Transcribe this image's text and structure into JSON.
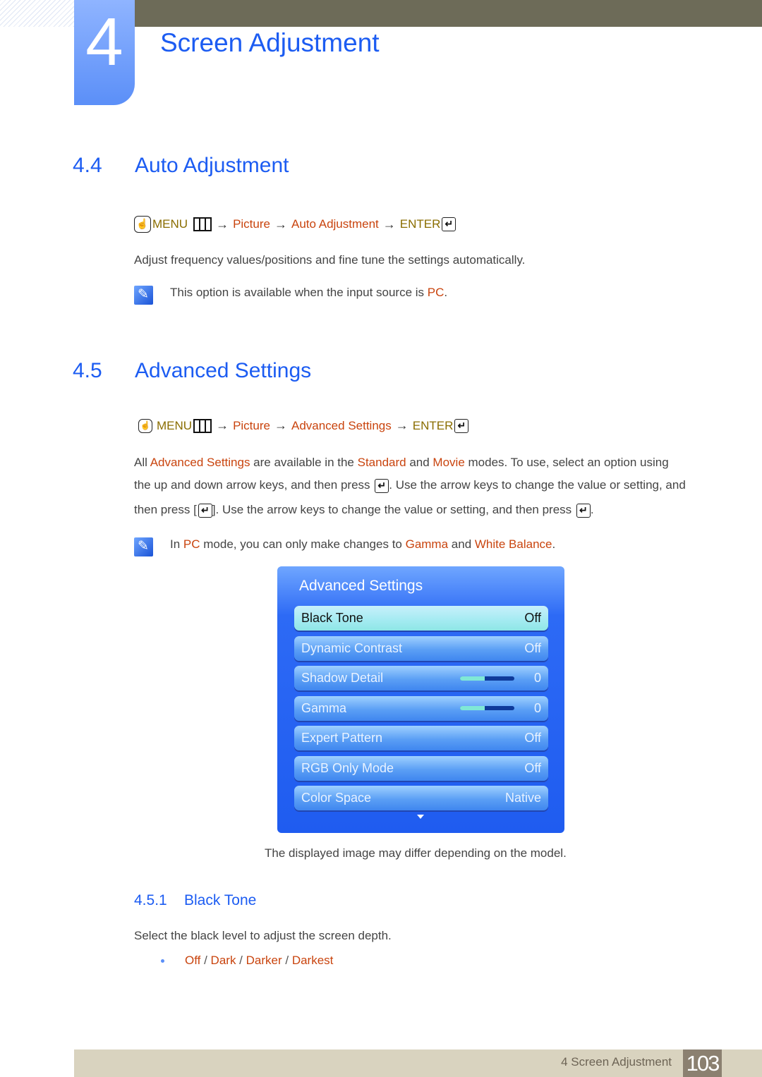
{
  "chapter": {
    "number": "4",
    "title": "Screen Adjustment"
  },
  "section_44": {
    "number": "4.4",
    "title": "Auto Adjustment",
    "menu_path": {
      "menu": "MENU",
      "arrow": "→",
      "items": [
        "Picture",
        "Auto Adjustment"
      ],
      "enter": "ENTER"
    },
    "description": "Adjust frequency values/positions and fine tune the settings automatically.",
    "note": {
      "text_before": "This option is available when the input source is ",
      "highlight": "PC",
      "text_after": "."
    }
  },
  "section_45": {
    "number": "4.5",
    "title": "Advanced Settings",
    "menu_path": {
      "menu": "MENU",
      "arrow": "→",
      "items": [
        "Picture",
        "Advanced Settings"
      ],
      "enter": "ENTER"
    },
    "paragraph": {
      "p1": "All ",
      "h1": "Advanced Settings",
      "p2": " are available in the ",
      "h2": "Standard",
      "p3": " and ",
      "h3": "Movie",
      "p4": " modes. To use, select an option using",
      "line2a": "the up and down arrow keys, and then press ",
      "line2b": ". Use the arrow keys to change the value or setting, and",
      "line3a": "then press [",
      "line3b": "]. Use the arrow keys to change the value or setting, and then press ",
      "line3c": "."
    },
    "note": {
      "t1": "In ",
      "h1": "PC",
      "t2": " mode, you can only make changes to ",
      "h2": "Gamma",
      "t3": " and ",
      "h3": "White Balance",
      "t4": "."
    },
    "osd": {
      "title": "Advanced Settings",
      "rows": [
        {
          "label": "Black Tone",
          "value": "Off",
          "selected": true
        },
        {
          "label": "Dynamic Contrast",
          "value": "Off"
        },
        {
          "label": "Shadow Detail",
          "value": "0",
          "slider_fraction": 0.45
        },
        {
          "label": "Gamma",
          "value": "0",
          "slider_fraction": 0.45
        },
        {
          "label": "Expert Pattern",
          "value": "Off"
        },
        {
          "label": "RGB Only Mode",
          "value": "Off"
        },
        {
          "label": "Color Space",
          "value": "Native"
        }
      ]
    },
    "caption": "The displayed image may differ depending on the model."
  },
  "section_451": {
    "number": "4.5.1",
    "title": "Black Tone",
    "description": "Select the black level to adjust the screen depth.",
    "options": [
      "Off",
      "Dark",
      "Darker",
      "Darkest"
    ],
    "separator": " / "
  },
  "footer": {
    "chapter_label": "4 Screen Adjustment",
    "page_number": "103"
  },
  "colors": {
    "heading_blue": "#1c5cf2",
    "highlight_rust": "#c9440e",
    "menu_olive": "#8a6d00",
    "top_bar": "#6d6b58",
    "footer_bg": "#d9d3bf",
    "page_num_bg": "#8b8070"
  }
}
